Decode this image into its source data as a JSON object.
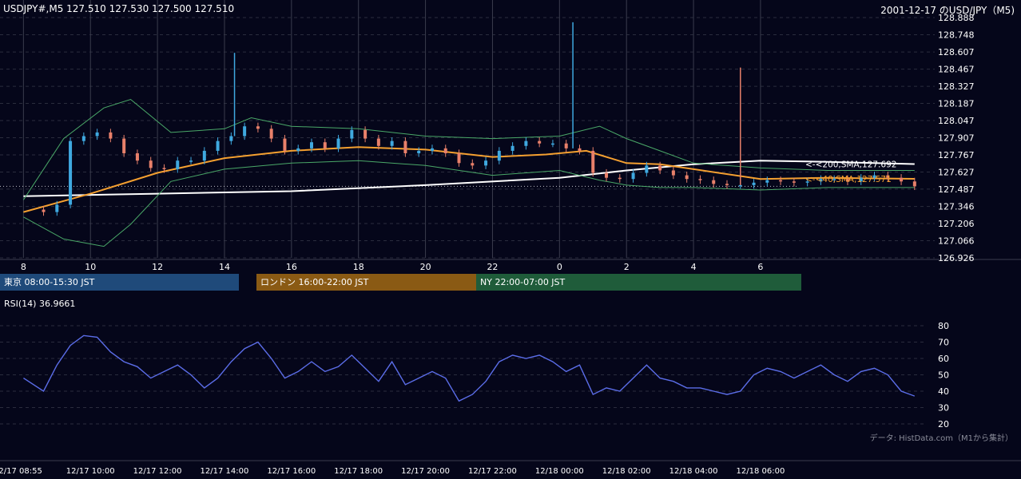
{
  "header": {
    "symbol_info": "USDJPY#,M5 127.510 127.530 127.500 127.510",
    "chart_title": "2001-12-17 のUSD/JPY（M5)"
  },
  "sessions": [
    {
      "label": "東京 08:00-15:30 JST",
      "color": "#1f4a7a"
    },
    {
      "label": "ロンドン 16:00-22:00 JST",
      "color": "#8a5a14"
    },
    {
      "label": "NY 22:00-07:00 JST",
      "color": "#1f5c3a"
    }
  ],
  "credit": "データ: HistData.com（M1から集計）",
  "colors": {
    "background": "#05061a",
    "grid": "#2a2c3d",
    "candle_up": "#3fa9e0",
    "candle_down": "#e8806a",
    "sma40": "#f5a030",
    "sma200": "#ffffff",
    "bollinger": "#4aa868",
    "rsi": "#5b6de8"
  },
  "chart_data": [
    {
      "type": "candlestick",
      "title": "",
      "x_ticks": [
        "8",
        "10",
        "12",
        "14",
        "16",
        "18",
        "20",
        "22",
        "0",
        "2",
        "4",
        "6"
      ],
      "y_ticks": [
        "128.888",
        "128.748",
        "128.607",
        "128.467",
        "128.327",
        "128.187",
        "128.047",
        "127.907",
        "127.767",
        "127.627",
        "127.487",
        "127.346",
        "127.206",
        "127.066",
        "126.926"
      ],
      "ylim": [
        126.926,
        128.888
      ],
      "grid": true,
      "last_close": 127.51,
      "close_path": [
        [
          0.0,
          127.32
        ],
        [
          0.3,
          127.3
        ],
        [
          0.5,
          127.36
        ],
        [
          0.7,
          127.88
        ],
        [
          0.9,
          127.92
        ],
        [
          1.1,
          127.95
        ],
        [
          1.3,
          127.9
        ],
        [
          1.5,
          127.78
        ],
        [
          1.7,
          127.72
        ],
        [
          1.9,
          127.66
        ],
        [
          2.1,
          127.65
        ],
        [
          2.3,
          127.72
        ],
        [
          2.5,
          127.72
        ],
        [
          2.7,
          127.8
        ],
        [
          2.9,
          127.88
        ],
        [
          3.1,
          127.92
        ],
        [
          3.3,
          128.0
        ],
        [
          3.5,
          127.98
        ],
        [
          3.7,
          127.9
        ],
        [
          3.9,
          127.8
        ],
        [
          4.1,
          127.82
        ],
        [
          4.3,
          127.87
        ],
        [
          4.5,
          127.82
        ],
        [
          4.7,
          127.9
        ],
        [
          4.9,
          127.97
        ],
        [
          5.1,
          127.9
        ],
        [
          5.3,
          127.84
        ],
        [
          5.5,
          127.88
        ],
        [
          5.7,
          127.78
        ],
        [
          5.9,
          127.8
        ],
        [
          6.1,
          127.82
        ],
        [
          6.3,
          127.78
        ],
        [
          6.5,
          127.7
        ],
        [
          6.7,
          127.68
        ],
        [
          6.9,
          127.72
        ],
        [
          7.1,
          127.8
        ],
        [
          7.3,
          127.84
        ],
        [
          7.5,
          127.88
        ],
        [
          7.7,
          127.86
        ],
        [
          7.9,
          127.86
        ],
        [
          8.1,
          127.82
        ],
        [
          8.3,
          127.8
        ],
        [
          8.5,
          127.62
        ],
        [
          8.7,
          127.58
        ],
        [
          8.9,
          127.57
        ],
        [
          9.1,
          127.62
        ],
        [
          9.3,
          127.68
        ],
        [
          9.5,
          127.64
        ],
        [
          9.7,
          127.6
        ],
        [
          9.9,
          127.57
        ],
        [
          10.1,
          127.56
        ],
        [
          10.3,
          127.53
        ],
        [
          10.5,
          127.52
        ],
        [
          10.7,
          127.52
        ],
        [
          10.9,
          127.54
        ],
        [
          11.1,
          127.56
        ],
        [
          11.3,
          127.55
        ],
        [
          11.5,
          127.54
        ],
        [
          11.7,
          127.55
        ],
        [
          11.9,
          127.57
        ],
        [
          12.1,
          127.57
        ],
        [
          12.3,
          127.55
        ],
        [
          12.5,
          127.58
        ],
        [
          12.7,
          127.6
        ],
        [
          12.9,
          127.58
        ],
        [
          13.1,
          127.55
        ],
        [
          13.3,
          127.51
        ]
      ],
      "spikes": [
        {
          "hour": 3.15,
          "high": 128.6,
          "color": "up"
        },
        {
          "hour": 8.2,
          "high": 128.85,
          "color": "up"
        },
        {
          "hour": 10.7,
          "high": 128.48,
          "color": "down"
        }
      ],
      "series": [
        {
          "name": "<-<200,SMA,127.692",
          "color": "#ffffff",
          "last_value": 127.692,
          "points": [
            [
              0,
              127.43
            ],
            [
              2,
              127.45
            ],
            [
              4,
              127.47
            ],
            [
              6,
              127.52
            ],
            [
              8,
              127.58
            ],
            [
              9,
              127.64
            ],
            [
              10,
              127.69
            ],
            [
              11,
              127.72
            ],
            [
              12,
              127.71
            ],
            [
              13.3,
              127.692
            ]
          ]
        },
        {
          "name": "<-<40,SMA,127.571",
          "color": "#f5a030",
          "last_value": 127.571,
          "points": [
            [
              0,
              127.3
            ],
            [
              1,
              127.45
            ],
            [
              2,
              127.62
            ],
            [
              3,
              127.74
            ],
            [
              4,
              127.8
            ],
            [
              5,
              127.83
            ],
            [
              6,
              127.81
            ],
            [
              7,
              127.75
            ],
            [
              7.8,
              127.77
            ],
            [
              8.4,
              127.8
            ],
            [
              9,
              127.7
            ],
            [
              9.5,
              127.69
            ],
            [
              10,
              127.65
            ],
            [
              11,
              127.57
            ],
            [
              12,
              127.58
            ],
            [
              13.3,
              127.571
            ]
          ]
        },
        {
          "name": "Bollinger upper",
          "color": "#4aa868",
          "points": [
            [
              0,
              127.4
            ],
            [
              0.6,
              127.9
            ],
            [
              1.2,
              128.15
            ],
            [
              1.6,
              128.22
            ],
            [
              2.2,
              127.95
            ],
            [
              3,
              127.98
            ],
            [
              3.4,
              128.07
            ],
            [
              4,
              128.0
            ],
            [
              5,
              127.98
            ],
            [
              6,
              127.92
            ],
            [
              7,
              127.9
            ],
            [
              8,
              127.92
            ],
            [
              8.6,
              128.0
            ],
            [
              9,
              127.9
            ],
            [
              9.5,
              127.8
            ],
            [
              10,
              127.7
            ],
            [
              11,
              127.66
            ],
            [
              12,
              127.64
            ],
            [
              13.3,
              127.64
            ]
          ]
        },
        {
          "name": "Bollinger lower",
          "color": "#4aa868",
          "points": [
            [
              0,
              127.26
            ],
            [
              0.6,
              127.08
            ],
            [
              1.2,
              127.02
            ],
            [
              1.6,
              127.2
            ],
            [
              2.2,
              127.55
            ],
            [
              3,
              127.65
            ],
            [
              4,
              127.7
            ],
            [
              5,
              127.72
            ],
            [
              6,
              127.68
            ],
            [
              7,
              127.6
            ],
            [
              8,
              127.64
            ],
            [
              8.6,
              127.56
            ],
            [
              9,
              127.52
            ],
            [
              9.5,
              127.5
            ],
            [
              10,
              127.5
            ],
            [
              11,
              127.48
            ],
            [
              12,
              127.5
            ],
            [
              13.3,
              127.5
            ]
          ]
        }
      ]
    },
    {
      "type": "line",
      "title": "RSI(14) 36.9661",
      "y_ticks": [
        "80",
        "70",
        "60",
        "50",
        "40",
        "30",
        "20"
      ],
      "ylim": [
        20,
        80
      ],
      "x_ticks": [
        "12/17 08:55",
        "12/17 10:00",
        "12/17 12:00",
        "12/17 14:00",
        "12/17 16:00",
        "12/17 18:00",
        "12/17 20:00",
        "12/17 22:00",
        "12/18 00:00",
        "12/18 02:00",
        "12/18 04:00",
        "12/18 06:00"
      ],
      "series": [
        {
          "name": "RSI(14)",
          "color": "#5b6de8",
          "last_value": 36.9661,
          "points": [
            [
              0.0,
              48
            ],
            [
              0.3,
              40
            ],
            [
              0.5,
              56
            ],
            [
              0.7,
              68
            ],
            [
              0.9,
              74
            ],
            [
              1.1,
              73
            ],
            [
              1.3,
              64
            ],
            [
              1.5,
              58
            ],
            [
              1.7,
              55
            ],
            [
              1.9,
              48
            ],
            [
              2.1,
              52
            ],
            [
              2.3,
              56
            ],
            [
              2.5,
              50
            ],
            [
              2.7,
              42
            ],
            [
              2.9,
              48
            ],
            [
              3.1,
              58
            ],
            [
              3.3,
              66
            ],
            [
              3.5,
              70
            ],
            [
              3.7,
              60
            ],
            [
              3.9,
              48
            ],
            [
              4.1,
              52
            ],
            [
              4.3,
              58
            ],
            [
              4.5,
              52
            ],
            [
              4.7,
              55
            ],
            [
              4.9,
              62
            ],
            [
              5.1,
              54
            ],
            [
              5.3,
              46
            ],
            [
              5.5,
              58
            ],
            [
              5.7,
              44
            ],
            [
              5.9,
              48
            ],
            [
              6.1,
              52
            ],
            [
              6.3,
              48
            ],
            [
              6.5,
              34
            ],
            [
              6.7,
              38
            ],
            [
              6.9,
              46
            ],
            [
              7.1,
              58
            ],
            [
              7.3,
              62
            ],
            [
              7.5,
              60
            ],
            [
              7.7,
              62
            ],
            [
              7.9,
              58
            ],
            [
              8.1,
              52
            ],
            [
              8.3,
              56
            ],
            [
              8.5,
              38
            ],
            [
              8.7,
              42
            ],
            [
              8.9,
              40
            ],
            [
              9.1,
              48
            ],
            [
              9.3,
              56
            ],
            [
              9.5,
              48
            ],
            [
              9.7,
              46
            ],
            [
              9.9,
              42
            ],
            [
              10.1,
              42
            ],
            [
              10.3,
              40
            ],
            [
              10.5,
              38
            ],
            [
              10.7,
              40
            ],
            [
              10.9,
              50
            ],
            [
              11.1,
              54
            ],
            [
              11.3,
              52
            ],
            [
              11.5,
              48
            ],
            [
              11.7,
              52
            ],
            [
              11.9,
              56
            ],
            [
              12.1,
              50
            ],
            [
              12.3,
              46
            ],
            [
              12.5,
              52
            ],
            [
              12.7,
              54
            ],
            [
              12.9,
              50
            ],
            [
              13.1,
              40
            ],
            [
              13.3,
              37
            ]
          ]
        }
      ]
    }
  ]
}
